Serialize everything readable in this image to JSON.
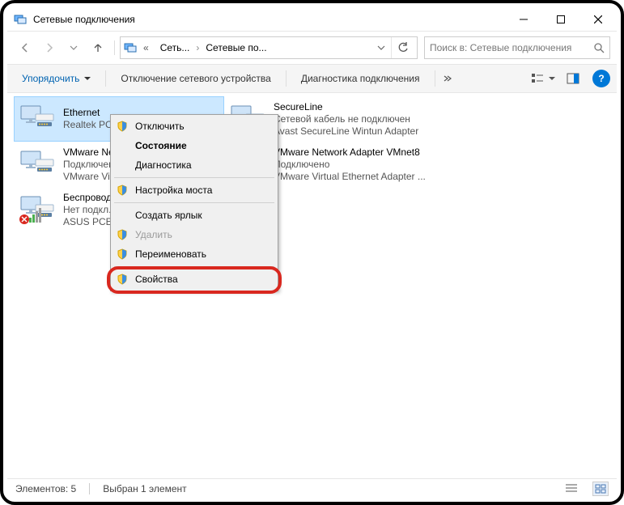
{
  "window": {
    "title": "Сетевые подключения"
  },
  "nav": {
    "crumb1": "Сеть...",
    "crumb2": "Сетевые по..."
  },
  "search": {
    "placeholder": "Поиск в: Сетевые подключения"
  },
  "toolbar": {
    "organize": "Упорядочить",
    "disable": "Отключение сетевого устройства",
    "diagnose": "Диагностика подключения"
  },
  "connections": [
    {
      "name": "Ethernet",
      "status": "",
      "adapter": "Realtek PCIe...",
      "selected": true,
      "badge": "none"
    },
    {
      "name": "SecureLine",
      "status": "Сетевой кабель не подключен",
      "adapter": "Avast SecureLine Wintun Adapter",
      "badge": "none"
    },
    {
      "name": "VMware Ne...",
      "status": "Подключено",
      "adapter": "VMware Vir...",
      "badge": "none"
    },
    {
      "name": "VMware Network Adapter VMnet8",
      "status": "Подключено",
      "adapter": "VMware Virtual Ethernet Adapter ...",
      "badge": "none"
    },
    {
      "name": "Беспровод...",
      "status": "Нет подкл...",
      "adapter": "ASUS PCE-N...",
      "badge": "error"
    }
  ],
  "ctxmenu": {
    "disable": "Отключить",
    "status": "Состояние",
    "diag": "Диагностика",
    "bridge": "Настройка моста",
    "shortcut": "Создать ярлык",
    "delete": "Удалить",
    "rename": "Переименовать",
    "props": "Свойства"
  },
  "statusbar": {
    "elements": "Элементов: 5",
    "selected": "Выбран 1 элемент"
  }
}
